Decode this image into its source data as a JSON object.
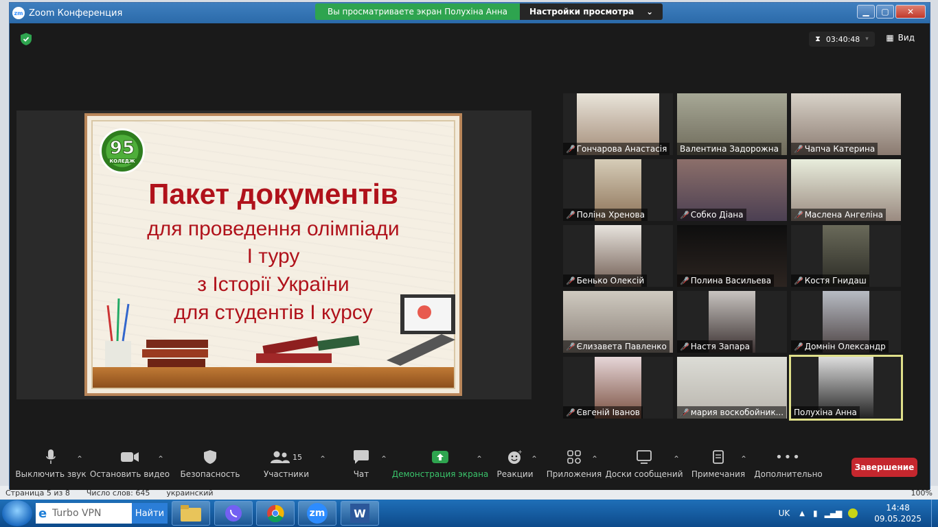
{
  "window": {
    "title": "Zoom Конференция",
    "app_icon_text": "zm"
  },
  "banner": {
    "sharing_text": "Вы просматриваете экран Полухіна Анна",
    "view_settings": "Настройки просмотра"
  },
  "topbar": {
    "timer": "03:40:48",
    "view_label": "Вид"
  },
  "slide": {
    "logo_number": "95",
    "logo_word": "КОЛЕДЖ",
    "title": "Пакет документів",
    "lines": [
      "для проведення олімпіади",
      "І туру",
      "з Історії України",
      "для студентів І курсу"
    ]
  },
  "participants": [
    "Гончарова Анастасія",
    "Валентина Задорожна",
    "Чапча Катерина",
    "Поліна Хренова",
    "Собко Діана",
    "Маслена Ангеліна",
    "Бенько Олексій",
    "Полина Васильева",
    "Костя Гнидаш",
    "Єлизавета Павленко",
    "Настя Запара",
    "Домнін Олександр",
    "Євгеній Іванов",
    "мария воскобойник...",
    "Полухіна Анна"
  ],
  "toolbar": {
    "mute": "Выключить звук",
    "video": "Остановить видео",
    "security": "Безопасность",
    "participants": "Участники",
    "participants_count": "15",
    "chat": "Чат",
    "share": "Демонстрация экрана",
    "reactions": "Реакции",
    "apps": "Приложения",
    "whiteboards": "Доски сообщений",
    "notes": "Примечания",
    "more": "Дополнительно",
    "end": "Завершение"
  },
  "word_status": {
    "page": "Страница 5 из 8",
    "words": "Число слов: 645",
    "lang": "украинский",
    "zoom": "100%"
  },
  "taskbar": {
    "search_text": "Turbo VPN",
    "search_button": "Найти",
    "lang": "UK",
    "time": "14:48",
    "date": "09.05.2025"
  },
  "colors": {
    "share_green": "#2ea44f",
    "slide_red": "#b0121b",
    "end_red": "#c5272e",
    "active_tile": "#e0e08a"
  }
}
